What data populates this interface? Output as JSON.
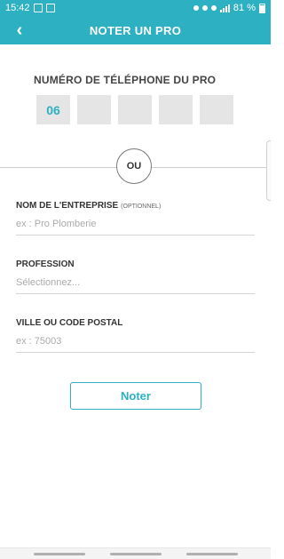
{
  "status_bar": {
    "time": "15:42",
    "battery": "81 %"
  },
  "app_bar": {
    "back_icon": "‹",
    "title": "NOTER UN PRO"
  },
  "phone": {
    "label": "NUMÉRO DE TÉLÉPHONE DU PRO",
    "segments": [
      "06",
      "",
      "",
      "",
      ""
    ]
  },
  "separator": {
    "or_label": "OU"
  },
  "company": {
    "label": "NOM DE L'ENTREPRISE",
    "optional": "(OPTIONNEL)",
    "placeholder": "ex : Pro Plomberie"
  },
  "profession": {
    "label": "PROFESSION",
    "placeholder": "Sélectionnez..."
  },
  "city": {
    "label": "VILLE OU CODE POSTAL",
    "placeholder": "ex : 75003"
  },
  "submit": {
    "label": "Noter"
  },
  "colors": {
    "accent": "#2cb0c2",
    "phone_box_bg": "#e5e5e5"
  }
}
